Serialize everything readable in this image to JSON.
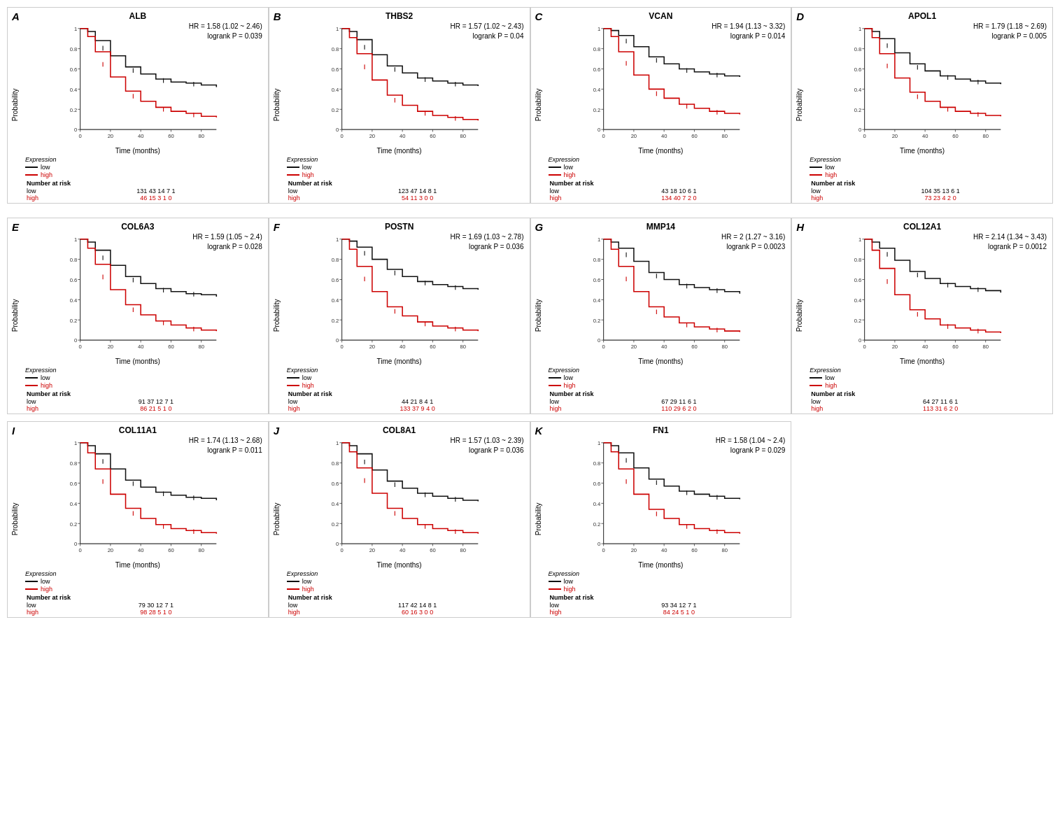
{
  "panels": [
    {
      "label": "A",
      "title": "ALB",
      "hr": "HR = 1.58 (1.02 ~ 2.46)",
      "logrank": "logrank P = 0.039",
      "risk_low": [
        131,
        43,
        14,
        7,
        1
      ],
      "risk_high": [
        46,
        15,
        3,
        1,
        0
      ],
      "time_points": [
        0,
        20,
        40,
        60,
        80
      ]
    },
    {
      "label": "B",
      "title": "THBS2",
      "hr": "HR = 1.57 (1.02 ~ 2.43)",
      "logrank": "logrank P = 0.04",
      "risk_low": [
        123,
        47,
        14,
        8,
        1
      ],
      "risk_high": [
        54,
        11,
        3,
        0,
        0
      ],
      "time_points": [
        0,
        20,
        40,
        60,
        80
      ]
    },
    {
      "label": "C",
      "title": "VCAN",
      "hr": "HR = 1.94 (1.13 ~ 3.32)",
      "logrank": "logrank P = 0.014",
      "risk_low": [
        43,
        18,
        10,
        6,
        1
      ],
      "risk_high": [
        134,
        40,
        7,
        2,
        0
      ],
      "time_points": [
        0,
        20,
        40,
        60,
        80
      ]
    },
    {
      "label": "D",
      "title": "APOL1",
      "hr": "HR = 1.79 (1.18 ~ 2.69)",
      "logrank": "logrank P = 0.005",
      "risk_low": [
        104,
        35,
        13,
        6,
        1
      ],
      "risk_high": [
        73,
        23,
        4,
        2,
        0
      ],
      "time_points": [
        0,
        20,
        40,
        60,
        80
      ]
    },
    {
      "label": "E",
      "title": "COL6A3",
      "hr": "HR = 1.59 (1.05 ~ 2.4)",
      "logrank": "logrank P = 0.028",
      "risk_low": [
        91,
        37,
        12,
        7,
        1
      ],
      "risk_high": [
        86,
        21,
        5,
        1,
        0
      ],
      "time_points": [
        0,
        20,
        40,
        60,
        80
      ]
    },
    {
      "label": "F",
      "title": "POSTN",
      "hr": "HR = 1.69 (1.03 ~ 2.78)",
      "logrank": "logrank P = 0.036",
      "risk_low": [
        44,
        21,
        8,
        4,
        1
      ],
      "risk_high": [
        133,
        37,
        9,
        4,
        0
      ],
      "time_points": [
        0,
        20,
        40,
        60,
        80
      ]
    },
    {
      "label": "G",
      "title": "MMP14",
      "hr": "HR = 2 (1.27 ~ 3.16)",
      "logrank": "logrank P = 0.0023",
      "risk_low": [
        67,
        29,
        11,
        6,
        1
      ],
      "risk_high": [
        110,
        29,
        6,
        2,
        0
      ],
      "time_points": [
        0,
        20,
        40,
        60,
        80
      ]
    },
    {
      "label": "H",
      "title": "COL12A1",
      "hr": "HR = 2.14 (1.34 ~ 3.43)",
      "logrank": "logrank P = 0.0012",
      "risk_low": [
        64,
        27,
        11,
        6,
        1
      ],
      "risk_high": [
        113,
        31,
        6,
        2,
        0
      ],
      "time_points": [
        0,
        20,
        40,
        60,
        80
      ]
    },
    {
      "label": "I",
      "title": "COL11A1",
      "hr": "HR = 1.74 (1.13 ~ 2.68)",
      "logrank": "logrank P = 0.011",
      "risk_low": [
        79,
        30,
        12,
        7,
        1
      ],
      "risk_high": [
        98,
        28,
        5,
        1,
        0
      ],
      "time_points": [
        0,
        20,
        40,
        60,
        80
      ]
    },
    {
      "label": "J",
      "title": "COL8A1",
      "hr": "HR = 1.57 (1.03 ~ 2.39)",
      "logrank": "logrank P = 0.036",
      "risk_low": [
        117,
        42,
        14,
        8,
        1
      ],
      "risk_high": [
        60,
        16,
        3,
        0,
        0
      ],
      "time_points": [
        0,
        20,
        40,
        60,
        80
      ]
    },
    {
      "label": "K",
      "title": "FN1",
      "hr": "HR = 1.58 (1.04 ~ 2.4)",
      "logrank": "logrank P = 0.029",
      "risk_low": [
        93,
        34,
        12,
        7,
        1
      ],
      "risk_high": [
        84,
        24,
        5,
        1,
        0
      ],
      "time_points": [
        0,
        20,
        40,
        60,
        80
      ]
    }
  ],
  "axis_labels": {
    "x": "Time (months)",
    "y": "Probability"
  },
  "legend_title": "Expression",
  "legend_items": [
    "low",
    "high"
  ],
  "risk_table_label": "Number at risk"
}
